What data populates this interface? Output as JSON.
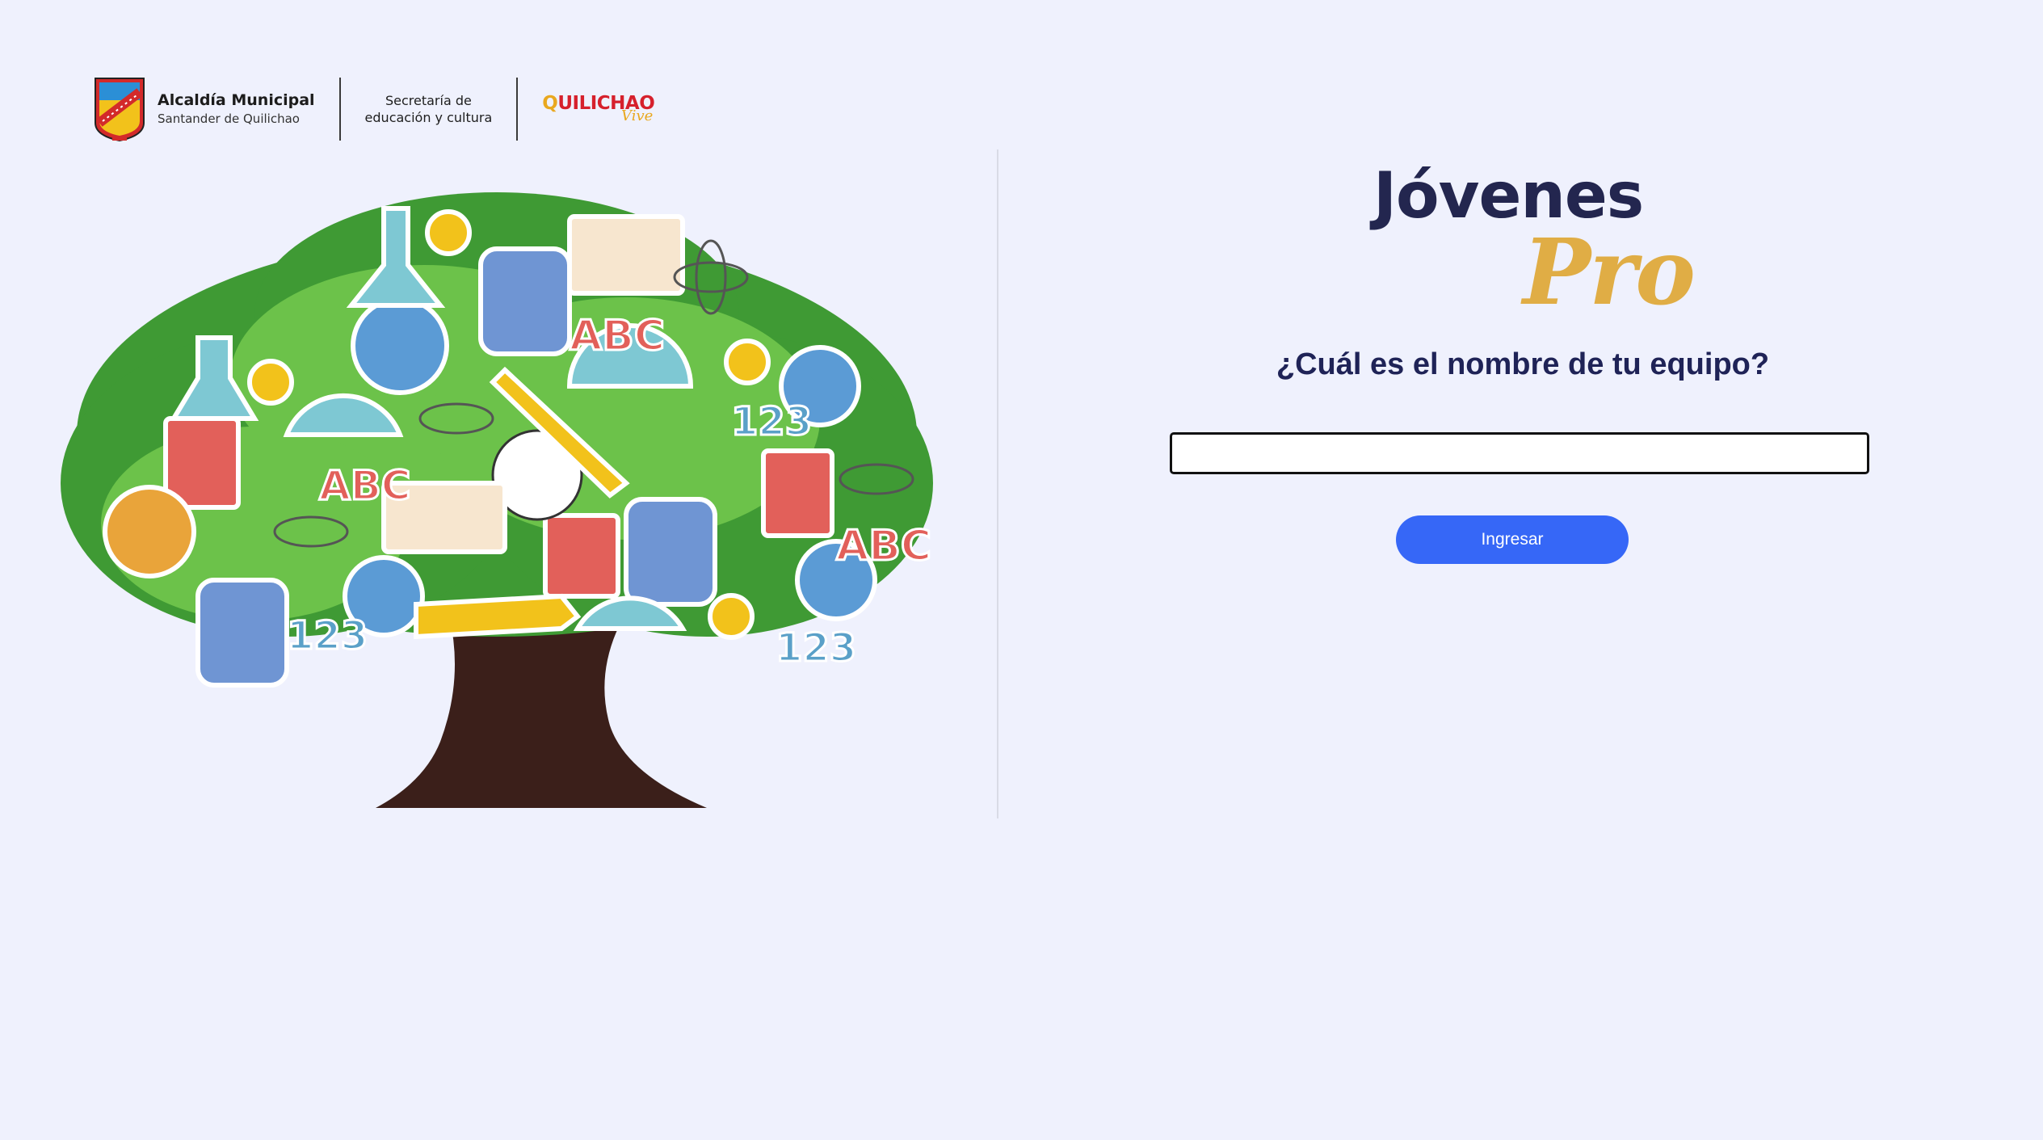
{
  "header": {
    "alcaldia_title": "Alcaldía Municipal",
    "alcaldia_subtitle": "Santander de Quilichao",
    "secretaria_line1": "Secretaría de",
    "secretaria_line2": "educación y cultura",
    "quilichao_word": "UILICHAO",
    "quilichao_q": "Q",
    "quilichao_sub": "Vive"
  },
  "tree": {
    "text_abc": "ABC",
    "text_123": "123"
  },
  "brand": {
    "line1": "Jóvenes",
    "line2": "Pro"
  },
  "form": {
    "question": "¿Cuál es el nombre de tu equipo?",
    "input_value": "",
    "submit_label": "Ingresar"
  },
  "colors": {
    "background": "#eff1fd",
    "brand_dark": "#23264f",
    "brand_gold": "#e0ad45",
    "button": "#3667f7"
  }
}
